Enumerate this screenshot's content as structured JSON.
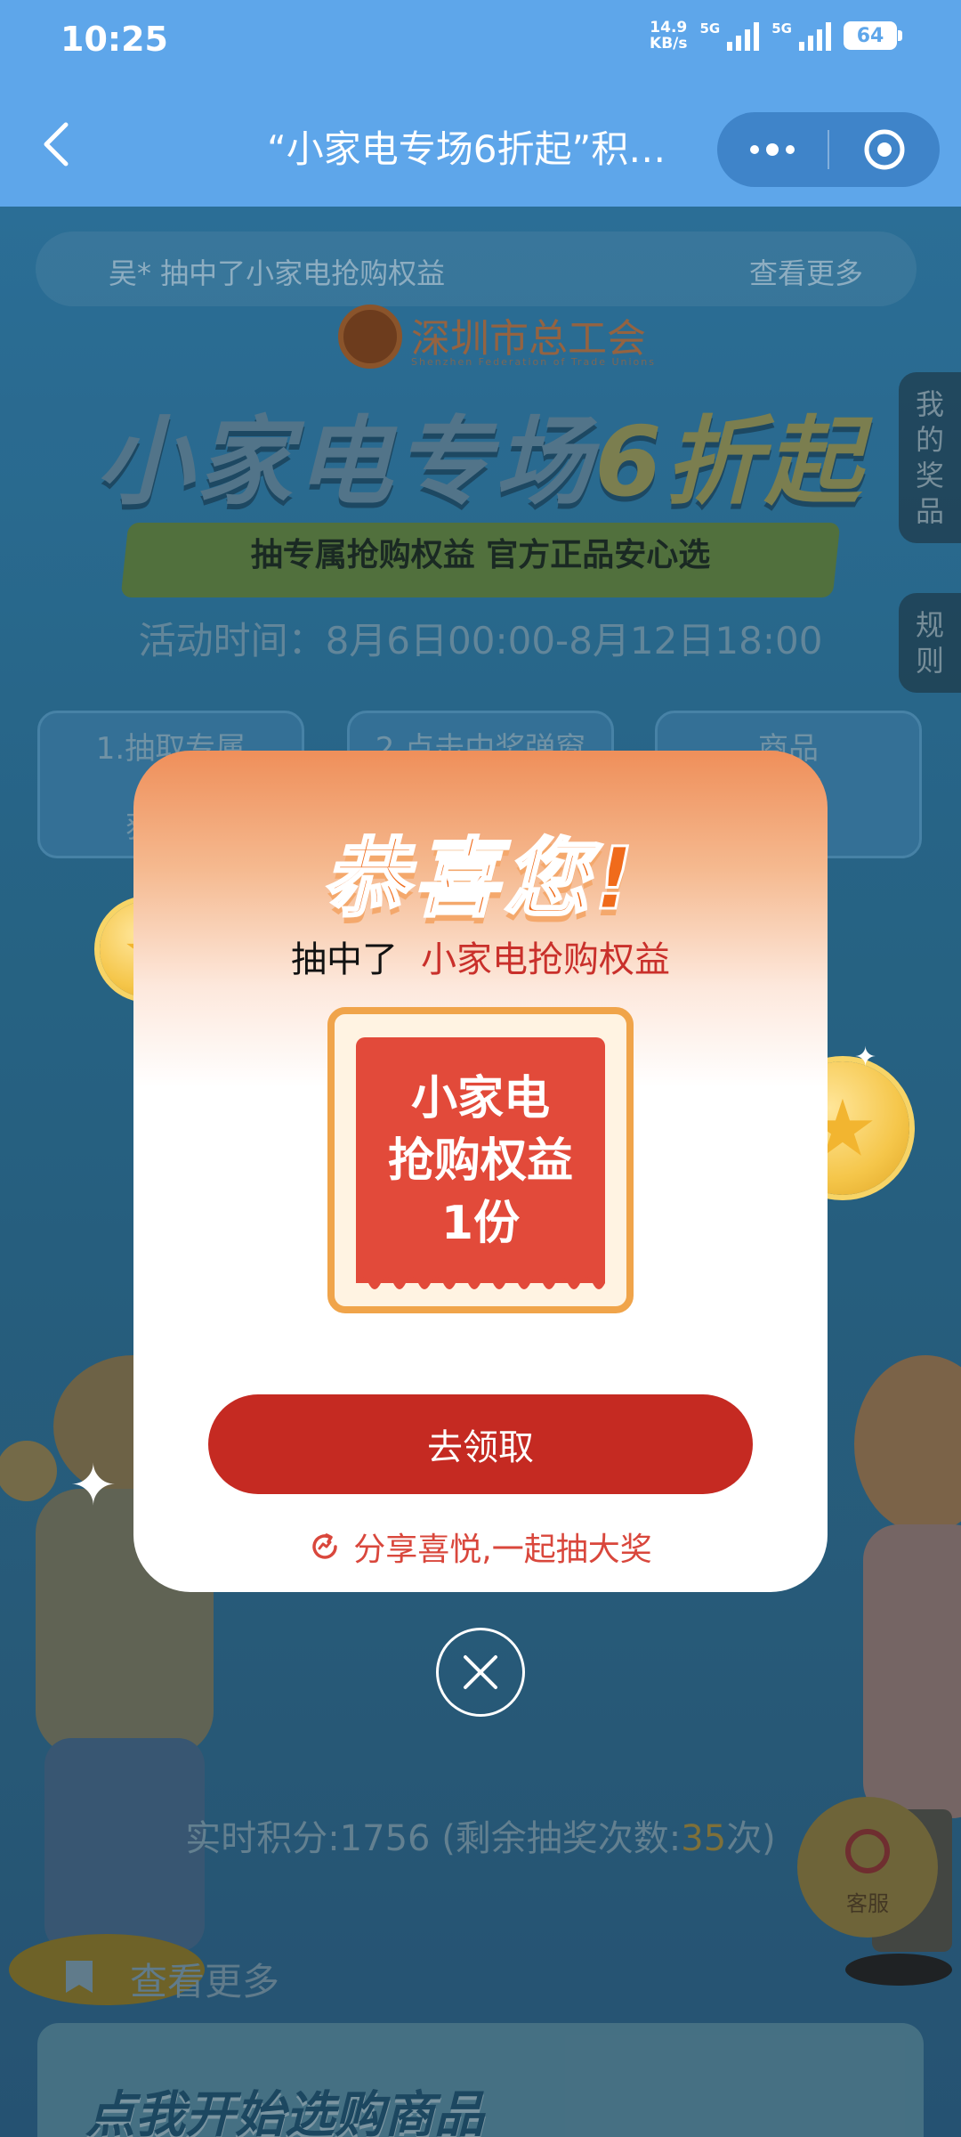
{
  "status_bar": {
    "time": "10:25",
    "net_speed_value": "14.9",
    "net_speed_unit": "KB/s",
    "sig1_label": "5G",
    "sig2_label": "5G",
    "battery": "64"
  },
  "nav": {
    "title": "“小家电专场6折起”积…"
  },
  "page": {
    "ticker_text": "吴* 抽中了小家电抢购权益",
    "ticker_more": "查看更多",
    "union_name": "深圳市总工会",
    "union_subtitle": "Shenzhen Federation of Trade Unions",
    "headline_a": "小家电专场",
    "headline_b": "6折起",
    "slogan": "抽专属抢购权益 官方正品安心选",
    "activity_time": "活动时间：8月6日00:00-8月12日18:00",
    "steps": [
      "1.抽取专属\n抢\n获得商",
      "2.点击中奖弹窗",
      "商品\n10件"
    ],
    "side_tab_prizes": "我\n的\n奖\n品",
    "side_tab_rules": "规\n则",
    "points_prefix": "实时积分:1756 (剩余抽奖次数:",
    "points_remaining": "35",
    "points_suffix": "次)",
    "service_label": "客服",
    "see_more": "查看更多",
    "shop_banner": "点我开始选购商品"
  },
  "modal": {
    "congrats": "恭喜您!",
    "drew_prefix": "抽中了",
    "drew_prize": "小家电抢购权益",
    "prize_line1": "小家电",
    "prize_line2": "抢购权益",
    "prize_line3": "1份",
    "claim_button": "去领取",
    "share_text": "分享喜悦,一起抽大奖"
  },
  "colors": {
    "nav_bg": "#5ea6ea",
    "modal_accent": "#c52a22",
    "congrats": "#f06b1b",
    "prize_card": "#e24a3a"
  }
}
